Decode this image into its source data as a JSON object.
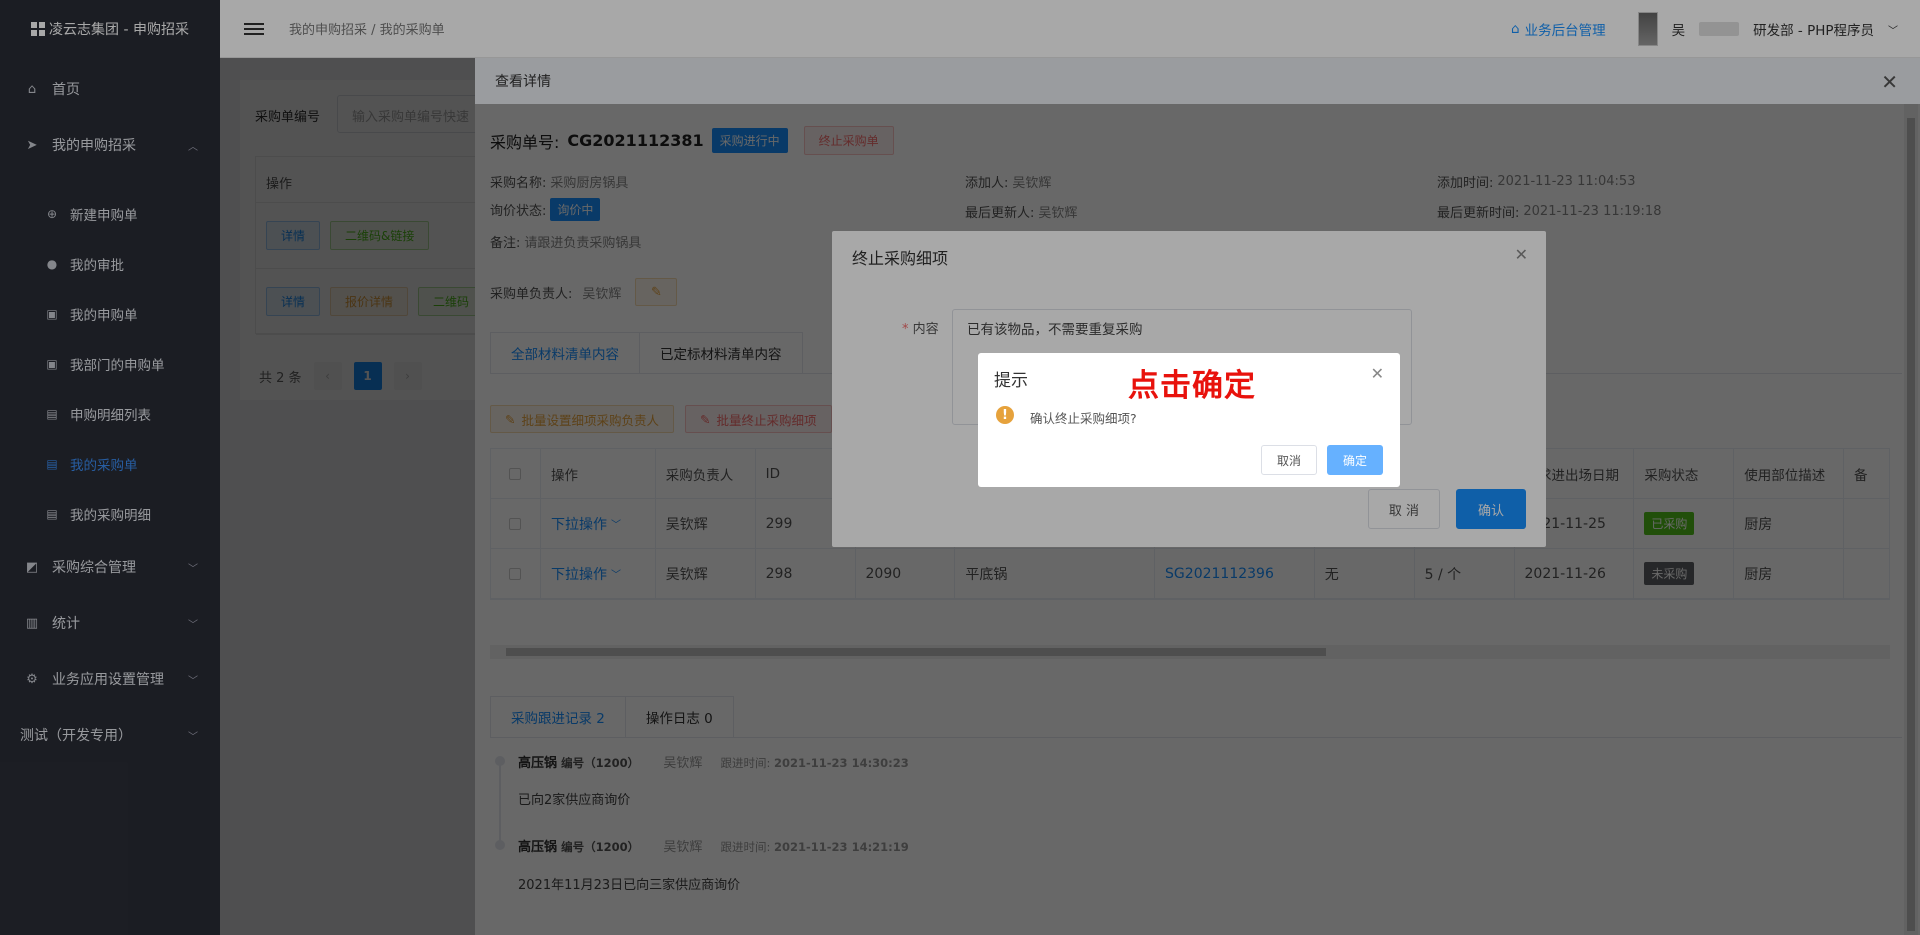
{
  "app": {
    "title": "凌云志集团 - 申购招采"
  },
  "sidebar": {
    "items": [
      {
        "label": "首页"
      },
      {
        "label": "我的申购招采"
      },
      {
        "label": "采购综合管理"
      },
      {
        "label": "统计"
      },
      {
        "label": "业务应用设置管理"
      },
      {
        "label": "测试（开发专用）"
      }
    ],
    "sub_items": [
      {
        "label": "新建申购单"
      },
      {
        "label": "我的审批"
      },
      {
        "label": "我的申购单"
      },
      {
        "label": "我部门的申购单"
      },
      {
        "label": "申购明细列表"
      },
      {
        "label": "我的采购单"
      },
      {
        "label": "我的采购明细"
      }
    ]
  },
  "header": {
    "breadcrumb": "我的申购招采 / 我的采购单",
    "backend_link": "业务后台管理",
    "user_initial": "吴",
    "department": "研发部 - PHP程序员"
  },
  "background_page": {
    "filter_label": "采购单编号",
    "filter_placeholder": "输入采购单编号快速",
    "table_header": "操作",
    "row1": {
      "detail": "详情",
      "qr": "二维码&链接"
    },
    "row2": {
      "detail": "详情",
      "quote": "报价详情",
      "qr": "二维码"
    },
    "total": "共 2 条",
    "page": "1"
  },
  "drawer": {
    "title": "查看详情",
    "po_label": "采购单号:",
    "po_number": "CG2021112381",
    "status_badge": "采购进行中",
    "terminate_button": "终止采购单",
    "info": {
      "name_label": "采购名称:",
      "name": "采购厨房锅具",
      "adder_label": "添加人:",
      "adder": "吴钦辉",
      "add_time_label": "添加时间:",
      "add_time": "2021-11-23 11:04:53",
      "inquiry_label": "询价状态:",
      "inquiry": "询价中",
      "updater_label": "最后更新人:",
      "updater": "吴钦辉",
      "update_time_label": "最后更新时间:",
      "update_time": "2021-11-23 11:19:18",
      "remark_label": "备注:",
      "remark": "请跟进负责采购锅具",
      "owner_label": "采购单负责人:",
      "owner": "吴钦辉"
    },
    "tabs": [
      "全部材料清单内容",
      "已定标材料清单内容"
    ],
    "batch_owner": "批量设置细项采购负责人",
    "batch_terminate": "批量终止采购细项",
    "table": {
      "headers": [
        "操作",
        "采购负责人",
        "ID",
        "要求进出场日期",
        "采购状态",
        "使用部位描述",
        "备"
      ],
      "rows": [
        {
          "action": "下拉操作",
          "owner": "吴钦辉",
          "id": "299",
          "code": "",
          "name": "",
          "sg": "",
          "none": "",
          "qty": "",
          "date": "2021-11-25",
          "status": "已采购",
          "part": "厨房"
        },
        {
          "action": "下拉操作",
          "owner": "吴钦辉",
          "id": "298",
          "code": "2090",
          "name": "平底锅",
          "sg": "SG2021112396",
          "none": "无",
          "qty": "5 / 个",
          "date": "2021-11-26",
          "status": "未采购",
          "part": "厨房"
        }
      ]
    },
    "tabs2": [
      "采购跟进记录 2",
      "操作日志 0"
    ],
    "records": [
      {
        "item": "高压锅",
        "code_label": "编号（1200）",
        "person": "吴钦辉",
        "time_label": "跟进时间:",
        "time": "2021-11-23 14:30:23",
        "text": "已向2家供应商询价"
      },
      {
        "item": "高压锅",
        "code_label": "编号（1200）",
        "person": "吴钦辉",
        "time_label": "跟进时间:",
        "time": "2021-11-23 14:21:19",
        "text": "2021年11月23日已向三家供应商询价"
      }
    ]
  },
  "terminate_dialog": {
    "title": "终止采购细项",
    "content_label": "内容",
    "content": "已有该物品，不需要重复采购",
    "cancel": "取 消",
    "confirm": "确认"
  },
  "confirm_box": {
    "title": "提示",
    "message": "确认终止采购细项?",
    "cancel": "取消",
    "confirm": "确定"
  },
  "annotation": "点击确定",
  "colors": {
    "primary": "#1890ff",
    "sidebar": "#2a2d36",
    "annotation": "#e8120c",
    "warning": "#e6a23c"
  }
}
